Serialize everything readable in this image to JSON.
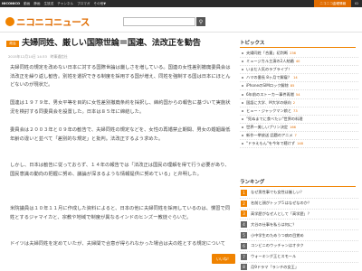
{
  "nav": {
    "items": [
      "NICONICO",
      "動画",
      "静画",
      "生放送",
      "チャンネル",
      "ブロマガ",
      "その他▼"
    ],
    "right": [
      "ニコニコ金曜情報",
      "ID"
    ]
  },
  "header": {
    "logo_text": "ニコニコニュース",
    "search_placeholder": "",
    "search_icon": "search-icon"
  },
  "article": {
    "category": "政治",
    "headline": "夫婦同姓、厳しい国際世論＝国連、法改正を勧告",
    "meta": "2015年12月14日 14:33　時事通信社",
    "paragraphs": [
      "夫婦同姓の規定を改めない日本に対する国際世論は厳しさを増している。国連の女性差別撤廃委員会は法改正を繰り返し勧告。別姓を選択できる制度を採用する国が増え、同姓を強制する国は日本にほとんどないのが現状だ。",
      "国連は１９７９年、男女平等を目的に女性差別撤廃条約を採択し、締約国からの報告に基づいて実施状況を検討する同委員会を設置した。日本は８５年に締結した。",
      "委員会は２００３年と０９年の勧告で、夫婦同姓の規定などを、女性の再婚禁止期間、男女の婚姻最低年齢の違いと並べて「差別的な規定」と批判。法改正するよう求めた。",
      "しかし、日本は勧告に従っておらず、１４年の報告では「法改正は国民の理解を得て行う必要があり、国民意識の動向の把握に努め、議論が深まるような情報提供に努めている」と弁明した。",
      "米院議員は１０年１１月に作成した資料によると、日本の他に夫婦同姓を採用しているのは、慣習で同姓とするジャマイカと、宗教や地域で制度が異なるインドのヒンズー教徒ぐらいだ。",
      "ドイツは夫婦同姓を定めていたが、夫婦間で合意が得られなかった場合は夫の姓とする規定について"
    ],
    "like_label": "いいね！"
  },
  "sidebar": {
    "topics_title": "トピックス",
    "topics": [
      {
        "text": "夫婦同姓「合憲」初判断",
        "count": "236"
      },
      {
        "text": "ミュージカル主演の2人結婚",
        "count": "40"
      },
      {
        "text": "いまだ人気のラブライブ！",
        "count": ""
      },
      {
        "text": "ハマの番長 8ヶ月で解雇？",
        "count": "14"
      },
      {
        "text": "iPhoneのSIMロック解除",
        "count": "85"
      },
      {
        "text": "6年前のストーカー事件再燃",
        "count": "54"
      },
      {
        "text": "国語に大学、M大学の傾向",
        "count": "2"
      },
      {
        "text": "ヒュー・ジャックマン娘と",
        "count": "73"
      },
      {
        "text": "\"死ぬまでに食べたい\"世界の料理",
        "count": ""
      },
      {
        "text": "世界一美しいプリン決定",
        "count": "166"
      },
      {
        "text": "新作一挙放送 話題のアニメ",
        "count": "7"
      },
      {
        "text": "\"ドラえもん\"を今年で聴けず",
        "count": "148"
      }
    ],
    "ranking_title": "ランキング",
    "ranking": [
      {
        "rank": "1",
        "text": "なぜ男性事でも女性は厳しい？"
      },
      {
        "rank": "2",
        "text": "名前と顔がトップ５はなぜなのか？"
      },
      {
        "rank": "3",
        "text": "高学歴がなぜ人として「高学歴」？"
      },
      {
        "rank": "4",
        "text": "大谷の仕事を私らは何に？"
      },
      {
        "rank": "5",
        "text": "小中学生のためうつ病の目覚め"
      },
      {
        "rank": "6",
        "text": "コンビニのウッチャンはオタク"
      },
      {
        "rank": "7",
        "text": "ウォーキング王とスモール"
      },
      {
        "rank": "8",
        "text": "月9ドラマ「ランチの女王」"
      }
    ]
  }
}
